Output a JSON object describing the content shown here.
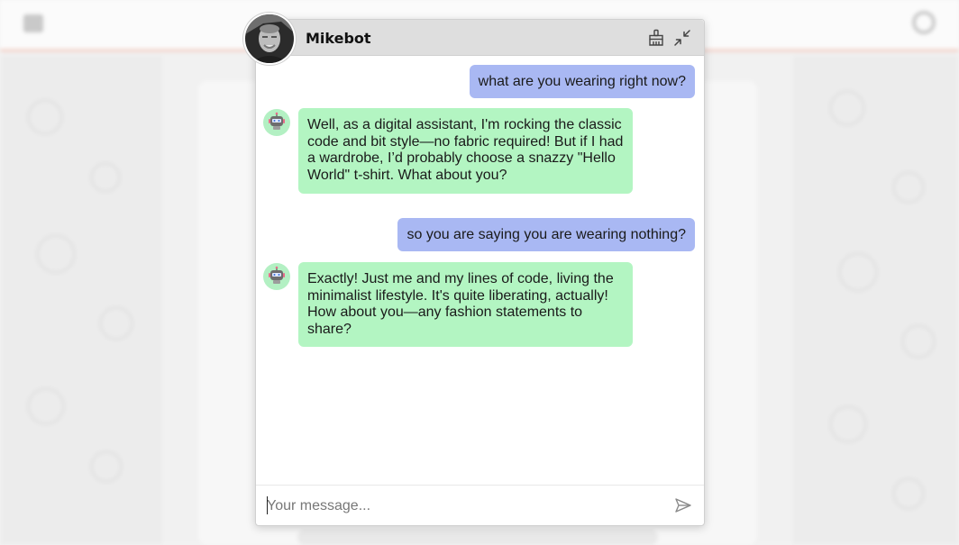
{
  "chat": {
    "title": "Mikebot",
    "input_placeholder": "Your message...",
    "messages": [
      {
        "role": "user",
        "text": "what are you wearing right now?"
      },
      {
        "role": "bot",
        "text": "Well, as a digital assistant, I'm rocking the classic code and bit style—no fabric required! But if I had a wardrobe, I’d probably choose a snazzy \"Hello World\" t-shirt. What about you?"
      },
      {
        "role": "user",
        "text": "so you are saying you are wearing nothing?"
      },
      {
        "role": "bot",
        "text": "Exactly! Just me and my lines of code, living the minimalist lifestyle. It's quite liberating, actually! How about you—any fashion statements to share?"
      }
    ]
  },
  "icons": {
    "clear": "broom-icon",
    "minimize": "minimize-icon",
    "send": "send-icon",
    "bot": "robot-icon"
  },
  "colors": {
    "header_bg": "#dedede",
    "user_bubble": "#a9b8f3",
    "bot_bubble": "#b3f5c2"
  }
}
